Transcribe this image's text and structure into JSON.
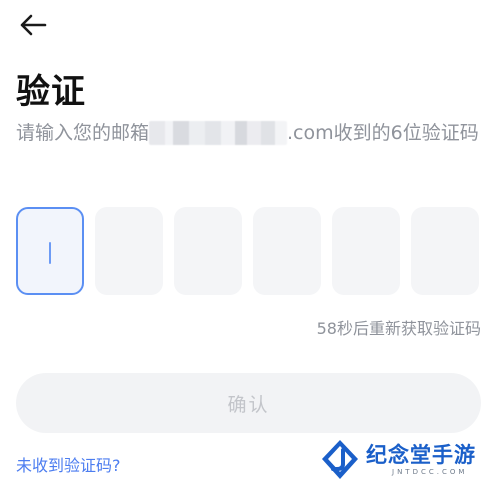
{
  "header": {
    "back_icon": "arrow-left-icon"
  },
  "page": {
    "title": "验证",
    "description_prefix": "请输入您的邮箱",
    "description_suffix": ".com收到的6位验证码"
  },
  "code": {
    "length": 6,
    "active_index": 0,
    "values": [
      "",
      "",
      "",
      "",
      "",
      ""
    ]
  },
  "resend": {
    "text": "58秒后重新获取验证码"
  },
  "confirm": {
    "label": "确认"
  },
  "help": {
    "not_received": "未收到验证码?"
  },
  "watermark": {
    "main": "纪念堂手游",
    "sub": "JNTDCC.COM"
  },
  "colors": {
    "accent": "#5b8ff3",
    "link": "#4c7df0",
    "muted_text": "#8f939b",
    "disabled_button_bg": "#f2f3f5",
    "disabled_button_text": "#c3c5ca"
  }
}
